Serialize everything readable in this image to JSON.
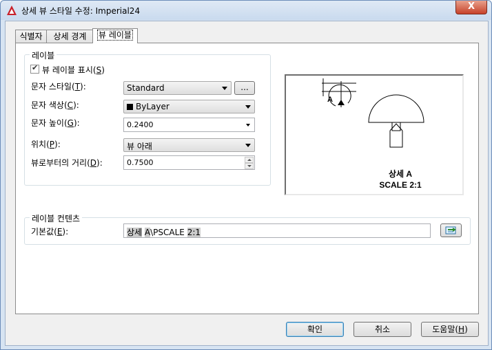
{
  "window": {
    "title": "상세 뷰 스타일 수정: Imperial24",
    "close_glyph": "X"
  },
  "tabs": [
    {
      "label": "식별자",
      "active": false
    },
    {
      "label": "상세 경계",
      "active": false
    },
    {
      "label": "뷰 레이블",
      "active": true
    }
  ],
  "label_group": {
    "title": "레이블",
    "show_label": {
      "text": "뷰 레이블 표시",
      "mnemonic": "S",
      "checked": true
    },
    "text_style": {
      "label": "문자 스타일",
      "mnemonic": "T",
      "value": "Standard",
      "browse_label": "..."
    },
    "text_color": {
      "label": "문자 색상",
      "mnemonic": "C",
      "value": "ByLayer"
    },
    "text_height": {
      "label": "문자 높이",
      "mnemonic": "G",
      "value": "0.2400"
    },
    "position": {
      "label": "위치",
      "mnemonic": "P",
      "value": "뷰 아래"
    },
    "distance": {
      "label": "뷰로부터의 거리",
      "mnemonic": "D",
      "value": "0.7500"
    }
  },
  "preview": {
    "line1": "상세 A",
    "line2": "SCALE 2:1",
    "callout_letter": "A"
  },
  "contents_group": {
    "title": "레이블 컨텐츠",
    "default": {
      "label": "기본값",
      "mnemonic": "E",
      "segments": [
        {
          "text": "상세",
          "highlight": true
        },
        {
          "text": " ",
          "highlight": false
        },
        {
          "text": "A",
          "highlight": true
        },
        {
          "text": "\\PSCALE ",
          "highlight": false
        },
        {
          "text": "2:1",
          "highlight": true
        }
      ]
    },
    "field_button_icon": "insert-field-icon"
  },
  "footer": {
    "ok": "확인",
    "cancel": "취소",
    "help": "도움말",
    "help_mnemonic": "H"
  },
  "colors": {
    "bylayer_swatch": "#000000",
    "accent": "#3c7fb1"
  }
}
